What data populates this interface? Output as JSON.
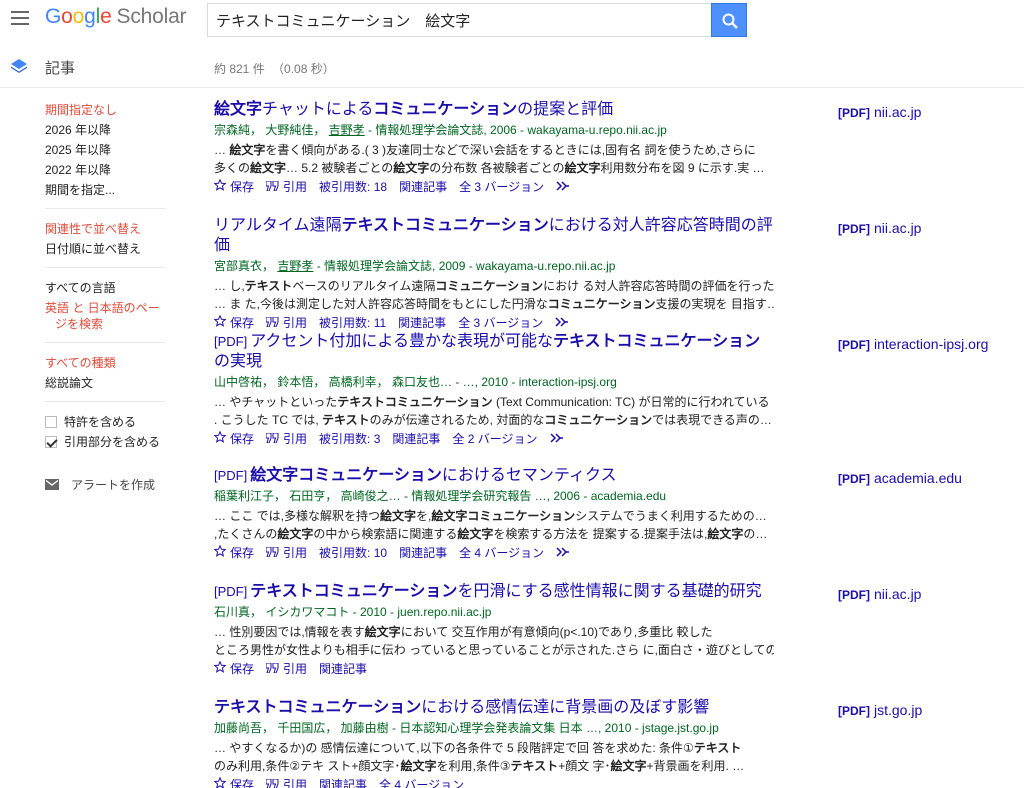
{
  "header": {
    "logo_google": "Google",
    "logo_scholar": "Scholar",
    "search_value": "テキストコミュニケーション　絵文字"
  },
  "subheader": {
    "section_label": "記事",
    "stats_count": "約 821 件",
    "stats_time": "（0.08 秒）"
  },
  "sidebar": {
    "time": [
      "期間指定なし",
      "2026 年以降",
      "2025 年以降",
      "2022 年以降",
      "期間を指定..."
    ],
    "sort": [
      "関連性で並べ替え",
      "日付順に並べ替え"
    ],
    "lang_all": "すべての言語",
    "lang_ja": "英語 と 日本語のページを検索",
    "types": [
      "すべての種類",
      "総説論文"
    ],
    "include_patents": "特許を含める",
    "include_citations": "引用部分を含める",
    "create_alert": "アラートを作成"
  },
  "labels": {
    "save": "保存",
    "cite": "引用",
    "related": "関連記事",
    "pdf": "[PDF]"
  },
  "results": [
    {
      "title_parts": [
        [
          "b",
          "絵文字"
        ],
        [
          "n",
          "チャットによる"
        ],
        [
          "b",
          "コミュニケーション"
        ],
        [
          "n",
          "の提案と評価"
        ]
      ],
      "authors": "宗森純， 大野純佳， ",
      "authors_link": "吉野孝",
      "venue": " - 情報処理学会論文誌, 2006 - wakayama-u.repo.nii.ac.jp",
      "snippet1": [
        [
          "n",
          "… "
        ],
        [
          "b",
          "絵文字"
        ],
        [
          "n",
          "を書く傾向がある.( 3 )友達同士などで深い会話をするときには,固有名 詞を使うため,さらに"
        ]
      ],
      "snippet2": [
        [
          "n",
          "多くの"
        ],
        [
          "b",
          "絵文字"
        ],
        [
          "n",
          "… 5.2 被験者ごとの"
        ],
        [
          "b",
          "絵文字"
        ],
        [
          "n",
          "の分布数 各被験者ごとの"
        ],
        [
          "b",
          "絵文字"
        ],
        [
          "n",
          "利用数分布を図 9 に示す.実 …"
        ]
      ],
      "cited_by": "被引用数: 18",
      "versions": "全 3 バージョン",
      "side": "nii.ac.jp"
    },
    {
      "title_parts": [
        [
          "n",
          "リアルタイム遠隔"
        ],
        [
          "b",
          "テキストコミュニケーション"
        ],
        [
          "n",
          "における対人許容応答時間の評価"
        ]
      ],
      "authors": "宮部真衣， ",
      "authors_link": "吉野孝",
      "venue": " - 情報処理学会論文誌, 2009 - wakayama-u.repo.nii.ac.jp",
      "snippet1": [
        [
          "n",
          "… し,"
        ],
        [
          "b",
          "テキスト"
        ],
        [
          "n",
          "ベースのリアルタイム遠隔"
        ],
        [
          "b",
          "コミュニケーション"
        ],
        [
          "n",
          "におけ る対人許容応答時間の評価を行った."
        ]
      ],
      "snippet2": [
        [
          "n",
          "… ま た,今後は測定した対人許容応答時間をもとにした円滑な"
        ],
        [
          "b",
          "コミュニケーション"
        ],
        [
          "n",
          "支援の実現を 目指す…"
        ]
      ],
      "cited_by": "被引用数: 11",
      "versions": "全 3 バージョン",
      "side": "nii.ac.jp"
    },
    {
      "pdf": true,
      "title_parts": [
        [
          "n",
          "アクセント付加による豊かな表現が可能な"
        ],
        [
          "b",
          "テキストコミュニケーション"
        ],
        [
          "n",
          "の実現"
        ]
      ],
      "authors": "山中啓祐， 鈴本悟， 高橋利幸， 森口友也… - …, 2010 - interaction-ipsj.org",
      "authors_link": "",
      "venue": "",
      "snippet1": [
        [
          "n",
          "… やチャットといった"
        ],
        [
          "b",
          "テキストコミュニケーション"
        ],
        [
          "n",
          " (Text Communication: TC) が日常的に行われている"
        ]
      ],
      "snippet2": [
        [
          "n",
          ". こうした TC では, "
        ],
        [
          "b",
          "テキスト"
        ],
        [
          "n",
          "のみが伝達されるため, 対面的な"
        ],
        [
          "b",
          "コミュニケーション"
        ],
        [
          "n",
          "では表現できる声の…"
        ]
      ],
      "cited_by": "被引用数: 3",
      "versions": "全 2 バージョン",
      "side": "interaction-ipsj.org"
    },
    {
      "pdf": true,
      "title_parts": [
        [
          "b",
          "絵文字コミュニケーション"
        ],
        [
          "n",
          "におけるセマンティクス"
        ]
      ],
      "authors": "稲葉利江子， 石田亨， 高崎俊之… - 情報処理学会研究報告 …, 2006 - academia.edu",
      "authors_link": "",
      "venue": "",
      "snippet1": [
        [
          "n",
          "… ここ では,多様な解釈を持つ"
        ],
        [
          "b",
          "絵文字"
        ],
        [
          "n",
          "を,"
        ],
        [
          "b",
          "絵文字コミュニケーション"
        ],
        [
          "n",
          "システムでうまく利用するための…"
        ]
      ],
      "snippet2": [
        [
          "n",
          ",たくさんの"
        ],
        [
          "b",
          "絵文字"
        ],
        [
          "n",
          "の中から検索語に関連する"
        ],
        [
          "b",
          "絵文字"
        ],
        [
          "n",
          "を検索する方法を 提案する.提案手法は,"
        ],
        [
          "b",
          "絵文字"
        ],
        [
          "n",
          "の…"
        ]
      ],
      "cited_by": "被引用数: 10",
      "versions": "全 4 バージョン",
      "side": "academia.edu"
    },
    {
      "pdf": true,
      "title_parts": [
        [
          "b",
          "テキストコミュニケーション"
        ],
        [
          "n",
          "を円滑にする感性情報に関する基礎的研究"
        ]
      ],
      "authors": "石川真， イシカワマコト - 2010 - juen.repo.nii.ac.jp",
      "authors_link": "",
      "venue": "",
      "snippet1": [
        [
          "n",
          "… 性別要因では,情報を表す"
        ],
        [
          "b",
          "絵文字"
        ],
        [
          "n",
          "において 交互作用が有意傾向(p<.10)であり,多重比 較した"
        ]
      ],
      "snippet2": [
        [
          "n",
          "ところ男性が女性よりも相手に伝わ っていると思っていることが示された.さら に,面白さ・遊びとしての…"
        ]
      ],
      "cited_by": "",
      "versions": "",
      "side": "nii.ac.jp"
    },
    {
      "title_parts": [
        [
          "b",
          "テキストコミュニケーション"
        ],
        [
          "n",
          "における感情伝達に背景画の及ぼす影響"
        ]
      ],
      "authors": "加藤尚吾， 千田国広， 加藤由樹 - 日本認知心理学会発表論文集 日本 …, 2010 - jstage.jst.go.jp",
      "authors_link": "",
      "venue": "",
      "snippet1": [
        [
          "n",
          "… やすくなるか)の 感情伝達について,以下の各条件で 5 段階評定で回 答を求めた: 条件①"
        ],
        [
          "b",
          "テキスト"
        ]
      ],
      "snippet2": [
        [
          "n",
          "のみ利用,条件②テキ スト+顔文字･"
        ],
        [
          "b",
          "絵文字"
        ],
        [
          "n",
          "を利用,条件③"
        ],
        [
          "b",
          "テキスト"
        ],
        [
          "n",
          "+顔文 字･"
        ],
        [
          "b",
          "絵文字"
        ],
        [
          "n",
          "+背景画を利用. …"
        ]
      ],
      "cited_by": "",
      "versions": "全 4 バージョン",
      "side": "jst.go.jp"
    }
  ]
}
